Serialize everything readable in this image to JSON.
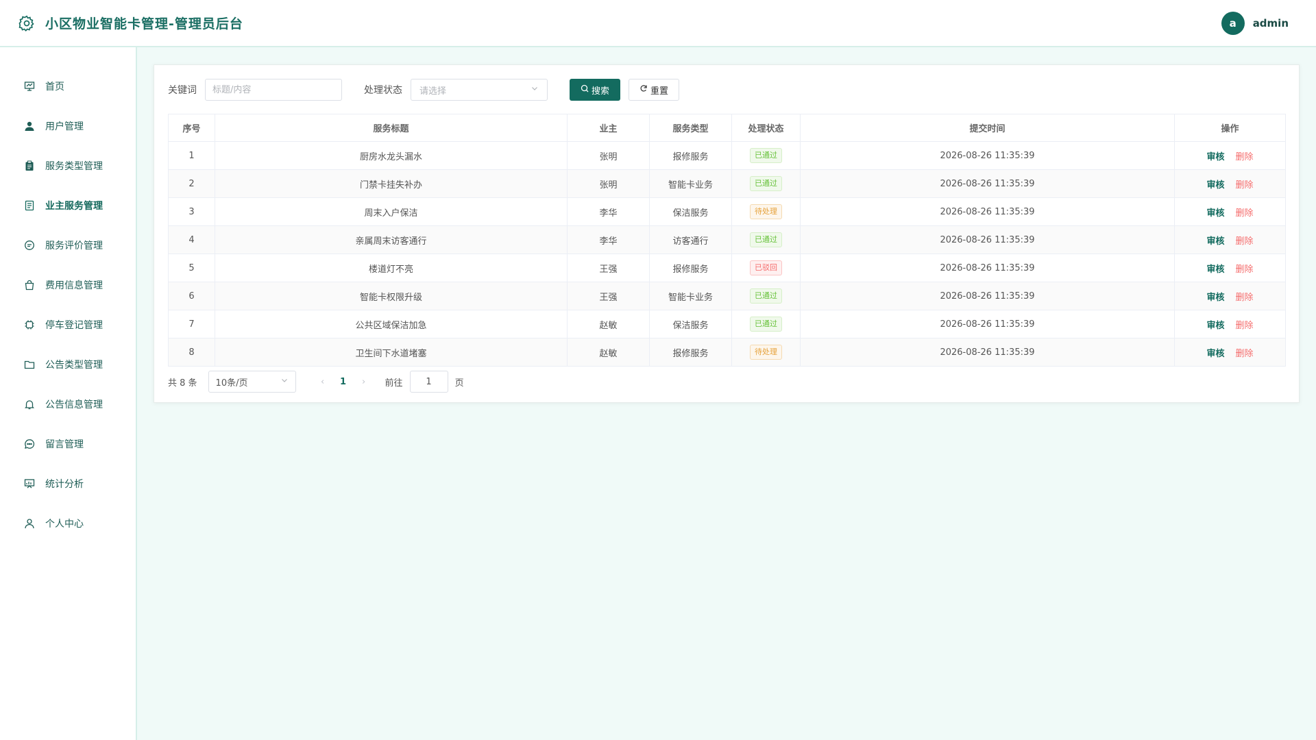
{
  "header": {
    "title": "小区物业智能卡管理-管理员后台",
    "avatar_letter": "a",
    "username": "admin"
  },
  "sidebar": {
    "items": [
      {
        "label": "首页",
        "icon": "presentation-icon"
      },
      {
        "label": "用户管理",
        "icon": "user-icon"
      },
      {
        "label": "服务类型管理",
        "icon": "clipboard-icon"
      },
      {
        "label": "业主服务管理",
        "icon": "document-icon",
        "active": true
      },
      {
        "label": "服务评价管理",
        "icon": "chat-bubble-icon"
      },
      {
        "label": "费用信息管理",
        "icon": "shopping-bag-icon"
      },
      {
        "label": "停车登记管理",
        "icon": "chip-icon"
      },
      {
        "label": "公告类型管理",
        "icon": "folder-icon"
      },
      {
        "label": "公告信息管理",
        "icon": "bell-icon"
      },
      {
        "label": "留言管理",
        "icon": "message-icon"
      },
      {
        "label": "统计分析",
        "icon": "chart-board-icon"
      },
      {
        "label": "个人中心",
        "icon": "person-icon"
      }
    ]
  },
  "filters": {
    "keyword_label": "关键词",
    "keyword_placeholder": "标题/内容",
    "status_label": "处理状态",
    "status_placeholder": "请选择",
    "search_label": "搜索",
    "reset_label": "重置"
  },
  "table": {
    "columns": [
      "序号",
      "服务标题",
      "业主",
      "服务类型",
      "处理状态",
      "提交时间",
      "操作"
    ],
    "review_label": "审核",
    "delete_label": "删除",
    "rows": [
      {
        "no": "1",
        "title": "厨房水龙头漏水",
        "owner": "张明",
        "type": "报修服务",
        "status": "已通过",
        "status_kind": "pass",
        "time": "2026-08-26 11:35:39"
      },
      {
        "no": "2",
        "title": "门禁卡挂失补办",
        "owner": "张明",
        "type": "智能卡业务",
        "status": "已通过",
        "status_kind": "pass",
        "time": "2026-08-26 11:35:39"
      },
      {
        "no": "3",
        "title": "周末入户保洁",
        "owner": "李华",
        "type": "保洁服务",
        "status": "待处理",
        "status_kind": "wait",
        "time": "2026-08-26 11:35:39"
      },
      {
        "no": "4",
        "title": "亲属周末访客通行",
        "owner": "李华",
        "type": "访客通行",
        "status": "已通过",
        "status_kind": "pass",
        "time": "2026-08-26 11:35:39"
      },
      {
        "no": "5",
        "title": "楼道灯不亮",
        "owner": "王强",
        "type": "报修服务",
        "status": "已驳回",
        "status_kind": "reject",
        "time": "2026-08-26 11:35:39"
      },
      {
        "no": "6",
        "title": "智能卡权限升级",
        "owner": "王强",
        "type": "智能卡业务",
        "status": "已通过",
        "status_kind": "pass",
        "time": "2026-08-26 11:35:39"
      },
      {
        "no": "7",
        "title": "公共区域保洁加急",
        "owner": "赵敏",
        "type": "保洁服务",
        "status": "已通过",
        "status_kind": "pass",
        "time": "2026-08-26 11:35:39"
      },
      {
        "no": "8",
        "title": "卫生间下水道堵塞",
        "owner": "赵敏",
        "type": "报修服务",
        "status": "待处理",
        "status_kind": "wait",
        "time": "2026-08-26 11:35:39"
      }
    ]
  },
  "pagination": {
    "total_text": "共 8 条",
    "page_size": "10条/页",
    "current_page": "1",
    "goto_label": "前往",
    "goto_value": "1",
    "page_suffix": "页"
  },
  "colors": {
    "primary": "#136b5f",
    "background": "#f0faf8",
    "danger": "#f56c6c"
  }
}
